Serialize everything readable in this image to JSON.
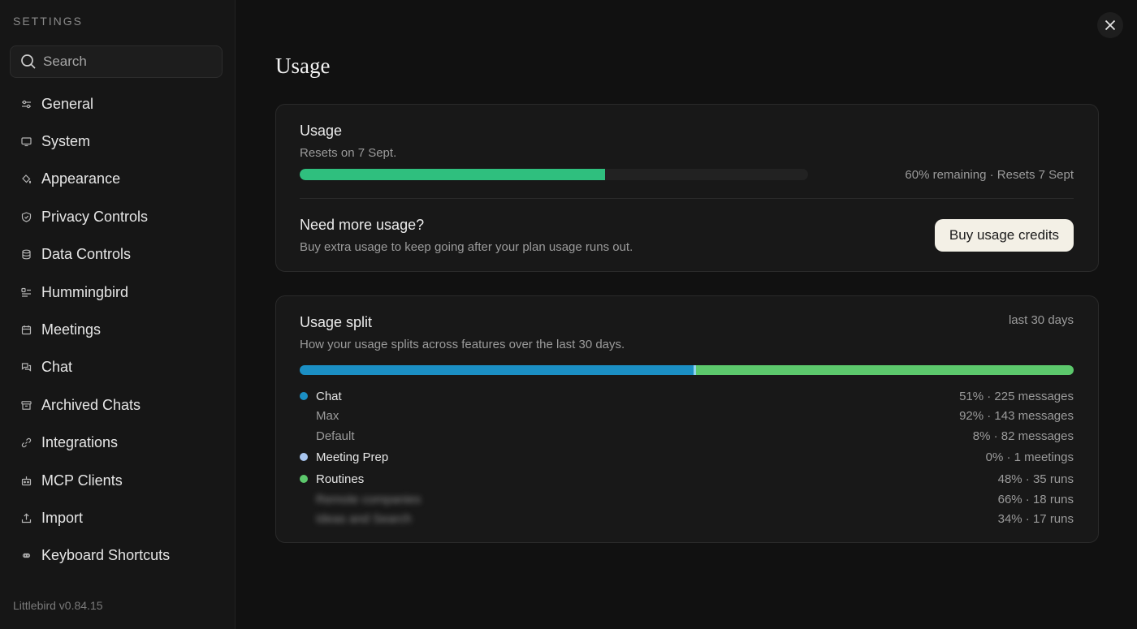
{
  "sidebar": {
    "heading": "SETTINGS",
    "search_placeholder": "Search",
    "items": [
      {
        "label": "General",
        "icon": "sliders-icon"
      },
      {
        "label": "System",
        "icon": "monitor-icon"
      },
      {
        "label": "Appearance",
        "icon": "paint-bucket-icon"
      },
      {
        "label": "Privacy Controls",
        "icon": "shield-icon"
      },
      {
        "label": "Data Controls",
        "icon": "database-icon"
      },
      {
        "label": "Hummingbird",
        "icon": "hummingbird-icon"
      },
      {
        "label": "Meetings",
        "icon": "calendar-icon"
      },
      {
        "label": "Chat",
        "icon": "chat-icon"
      },
      {
        "label": "Archived Chats",
        "icon": "archive-icon"
      },
      {
        "label": "Integrations",
        "icon": "link-icon"
      },
      {
        "label": "MCP Clients",
        "icon": "plug-icon"
      },
      {
        "label": "Import",
        "icon": "upload-icon"
      },
      {
        "label": "Keyboard Shortcuts",
        "icon": "command-icon"
      }
    ],
    "version": "Littlebird v0.84.15"
  },
  "page": {
    "title": "Usage"
  },
  "usage_card": {
    "title": "Usage",
    "reset_text": "Resets on 7 Sept.",
    "used_fraction": 0.6,
    "bar_color": "#2fbf7e",
    "meta": "60% remaining · Resets 7 Sept",
    "more_title": "Need more usage?",
    "more_desc": "Buy extra usage to keep going after your plan usage runs out.",
    "buy_label": "Buy usage credits"
  },
  "split_card": {
    "title": "Usage split",
    "desc": "How your usage splits across features over the last 30 days.",
    "period": "last 30 days",
    "bar": [
      {
        "name": "Chat",
        "percent": 51,
        "color": "#1b8fc4"
      },
      {
        "name": "Routines",
        "percent": 49,
        "color": "#5cc86c"
      }
    ],
    "rows": [
      {
        "label": "Chat",
        "value": "51% · 225 messages",
        "dot": "#1b8fc4",
        "sub": false,
        "blur": false
      },
      {
        "label": "Max",
        "value": "92% · 143 messages",
        "sub": true,
        "blur": false
      },
      {
        "label": "Default",
        "value": "8% · 82 messages",
        "sub": true,
        "blur": false
      },
      {
        "label": "Meeting Prep",
        "value": "0% · 1 meetings",
        "dot": "#a9c6f0",
        "sub": false,
        "blur": false
      },
      {
        "label": "Routines",
        "value": "48% · 35 runs",
        "dot": "#5cc86c",
        "sub": false,
        "blur": false
      },
      {
        "label": "Remote companies",
        "value": "66% · 18 runs",
        "sub": true,
        "blur": true
      },
      {
        "label": "Ideas and Search",
        "value": "34% · 17 runs",
        "sub": true,
        "blur": true
      }
    ]
  }
}
